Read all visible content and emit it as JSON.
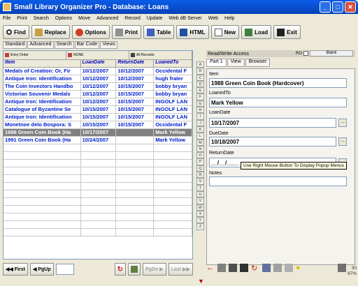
{
  "window": {
    "title": "Small Library Organizer Pro - Database: Loans"
  },
  "menu": [
    "File",
    "Print",
    "Search",
    "Options",
    "Move",
    "Advanced",
    "Record",
    "Update",
    "Web dB Server",
    "Web",
    "Help"
  ],
  "toolbar": {
    "find": "Find",
    "replace": "Replace",
    "options": "Options",
    "print": "Print",
    "table": "Table",
    "html": "HTML",
    "new": "New",
    "load": "Load",
    "exit": "Exit"
  },
  "view_tabs": [
    "Standard",
    "Advanced",
    "Search",
    "Bar Code",
    "Views"
  ],
  "sortbar": {
    "entry_order": "Entry Order",
    "none": "NONE",
    "all_records": "All Records"
  },
  "grid": {
    "headers": [
      "Item",
      "LoanDate",
      "ReturnDate",
      "LoanedTo"
    ],
    "rows": [
      [
        "Medals of Creation: Or, Fir",
        "10/12/2007",
        "10/12/2007",
        "Occidental F"
      ],
      [
        "Antique Iron: Identification",
        "10/12/2007",
        "10/12/2007",
        "hugh frater"
      ],
      [
        "The Coin Investors Handbo",
        "10/12/2007",
        "10/15/2007",
        "bobby bryan"
      ],
      [
        "Victorian Souvenir Medals",
        "10/12/2007",
        "10/15/2007",
        "bobby bryan"
      ],
      [
        "Antique Iron: Identification",
        "10/12/2007",
        "10/15/2007",
        "INGOLF LAN"
      ],
      [
        "Catalogue of Byzantine Se",
        "10/15/2007",
        "10/15/2007",
        "INGOLF LAN"
      ],
      [
        "Antique Iron: Identification",
        "10/15/2007",
        "10/15/2007",
        "INGOLF LAN"
      ],
      [
        "Monetnoe delo Bospora: S",
        "10/15/2007",
        "10/15/2007",
        "Occidental F"
      ],
      [
        "1988 Green Coin Book (Ha",
        "10/17/2007",
        "",
        "Mark Yellow"
      ],
      [
        "1991 Green Coin Book (Ha",
        "10/24/2007",
        "",
        "Mark Yellow"
      ]
    ],
    "selected_index": 8
  },
  "nav": {
    "first": "First",
    "pgup": "PgUp",
    "pgdn": "PgDn",
    "last": "Last"
  },
  "alpha": [
    "A",
    "B",
    "C",
    "D",
    "E",
    "F",
    "G",
    "H",
    "I",
    "J",
    "K",
    "L",
    "M",
    "N",
    "O",
    "P",
    "Q",
    "R",
    "S",
    "T",
    "U",
    "V",
    "W",
    "X",
    "Y",
    "Z"
  ],
  "right": {
    "access": "Read/Write Access",
    "ro": "RO",
    "blank": "Blank",
    "tabs": [
      "Part 1",
      "View",
      "Browser"
    ],
    "fields": {
      "item_label": "Item",
      "item_value": "1988 Green Coin Book (Hardcover)",
      "loanedto_label": "LoanedTo",
      "loanedto_value": "Mark Yellow",
      "loandate_label": "LoanDate",
      "loandate_value": "10/17/2007",
      "duedate_label": "DueDate",
      "duedate_value": "10/18/2007",
      "returndate_label": "ReturnDate",
      "returndate_value": "__/__/____",
      "notes_label": "Notes",
      "notes_value": ""
    },
    "tooltip": "Use Right Mouse Button To Display Popup Menus"
  },
  "status": {
    "count": "30",
    "zoom": "97%"
  }
}
